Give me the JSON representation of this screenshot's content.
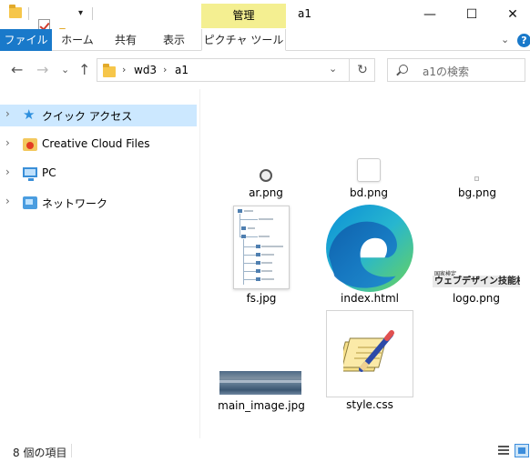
{
  "window": {
    "title": "a1",
    "context_tab_label": "管理",
    "controls": {
      "minimize": "—",
      "maximize": "☐",
      "close": "✕"
    }
  },
  "ribbon": {
    "tabs": [
      {
        "label": "ファイル",
        "active": true
      },
      {
        "label": "ホーム"
      },
      {
        "label": "共有"
      },
      {
        "label": "表示"
      },
      {
        "label": "ピクチャ ツール"
      }
    ],
    "help": "?",
    "collapse": "⌄"
  },
  "navigation": {
    "back": "←",
    "forward": "→",
    "recent": "⌄",
    "up": "↑",
    "breadcrumb": [
      "wd3",
      "a1"
    ],
    "crumb_sep": "›",
    "address_dropdown": "⌄",
    "refresh": "↻",
    "search_placeholder": "a1の検索"
  },
  "sidebar": {
    "items": [
      {
        "label": "クイック アクセス",
        "icon": "star-icon",
        "selected": true
      },
      {
        "label": "Creative Cloud Files",
        "icon": "creative-cloud-folder-icon"
      },
      {
        "label": "PC",
        "icon": "pc-icon"
      },
      {
        "label": "ネットワーク",
        "icon": "network-icon"
      }
    ],
    "chevron": "›"
  },
  "files": [
    {
      "name": "ar.png"
    },
    {
      "name": "bd.png"
    },
    {
      "name": "bg.png"
    },
    {
      "name": "fs.jpg"
    },
    {
      "name": "index.html"
    },
    {
      "name": "logo.png",
      "thumb_small_text": "国家検定",
      "thumb_text": "ウェブデザイン技能検定"
    },
    {
      "name": "main_image.jpg"
    },
    {
      "name": "style.css"
    }
  ],
  "status": {
    "item_count": "8 個の項目"
  },
  "colors": {
    "accent": "#1979ca",
    "context_tab": "#f4ef91",
    "selection": "#cce8ff"
  }
}
